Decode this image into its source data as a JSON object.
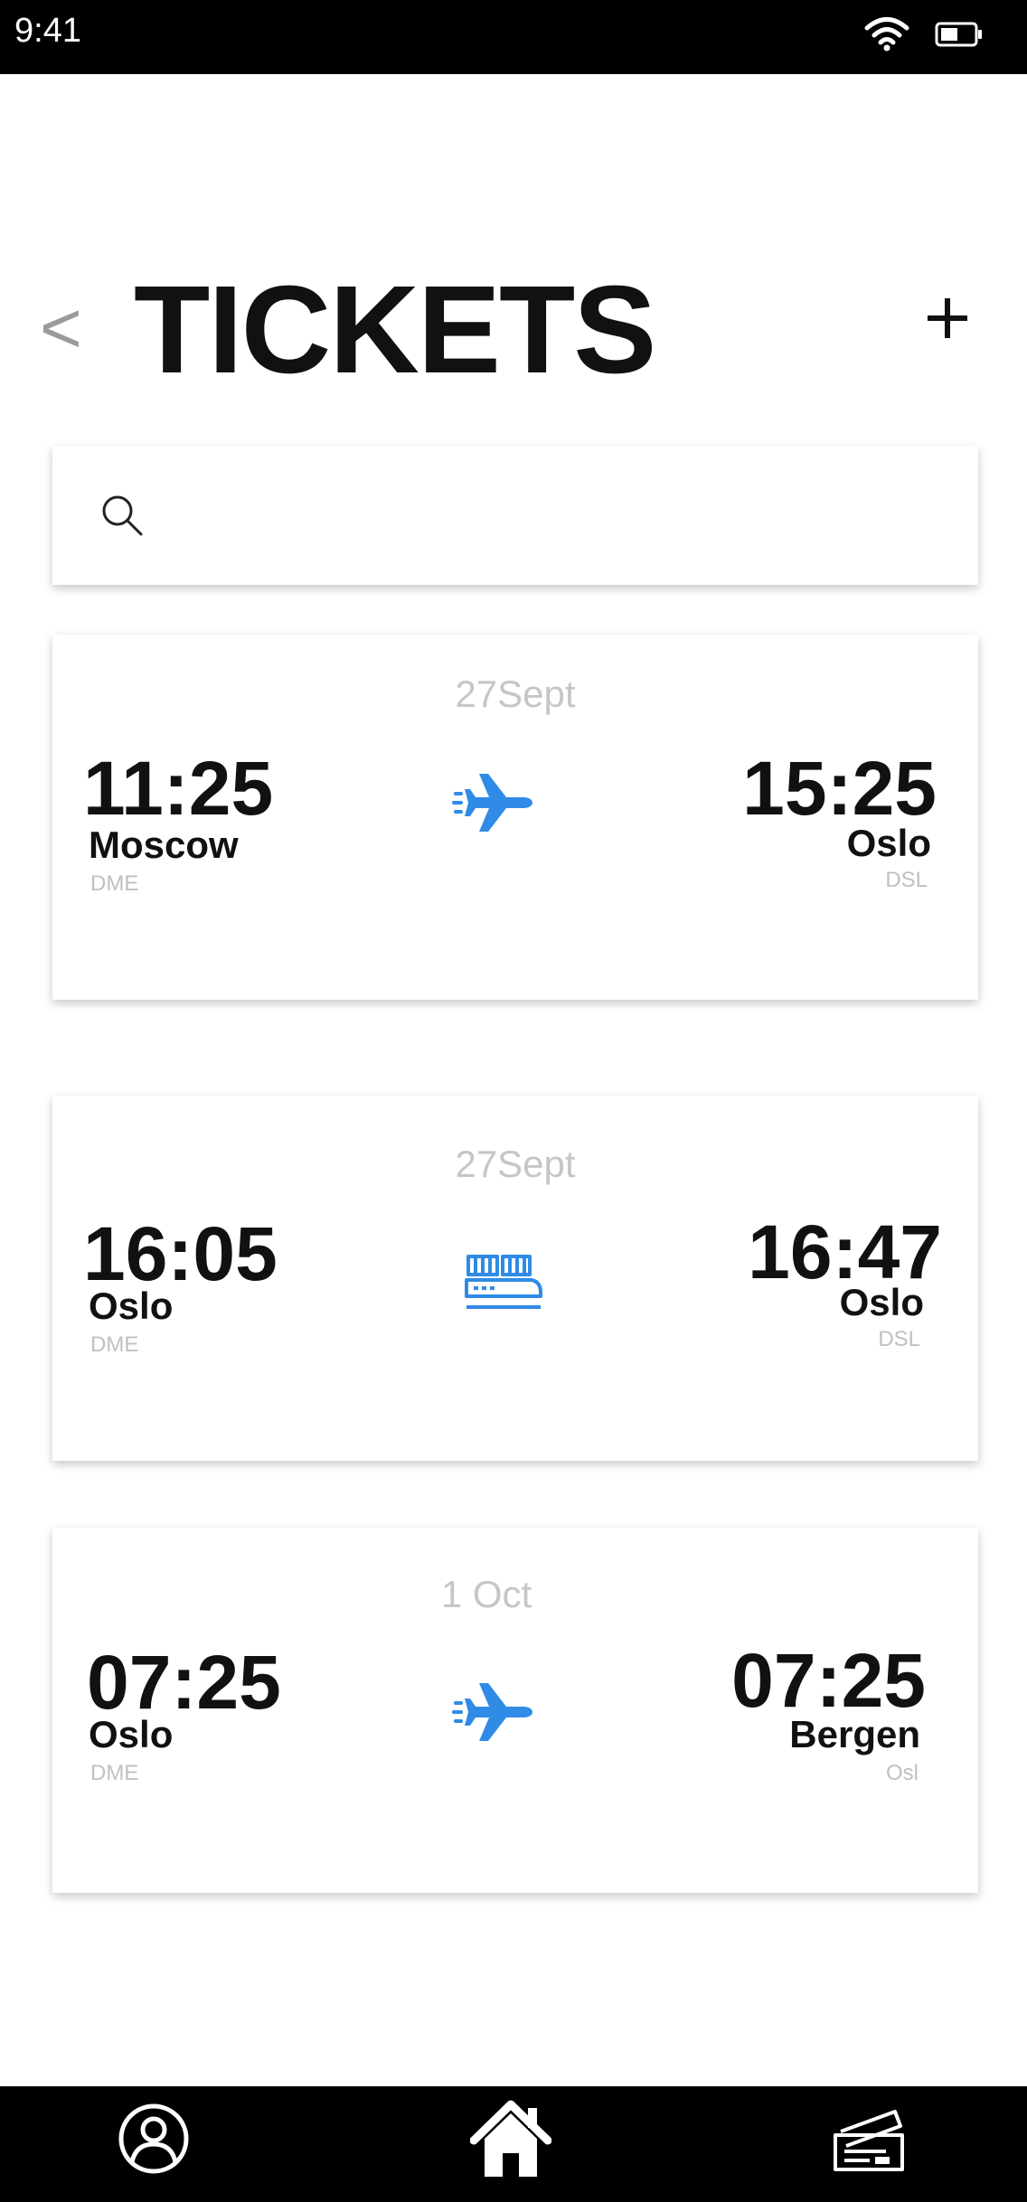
{
  "status_bar": {
    "time": "9:41"
  },
  "header": {
    "back_label": "<",
    "title": "TICKETS",
    "add_label": "+"
  },
  "search": {
    "placeholder": "",
    "value": ""
  },
  "tickets": [
    {
      "date": "27Sept",
      "transport": "airplane-icon",
      "departure": {
        "time": "11:25",
        "city": "Moscow",
        "code": "DME"
      },
      "arrival": {
        "time": "15:25",
        "city": "Oslo",
        "code": "DSL"
      }
    },
    {
      "date": "27Sept",
      "transport": "ferry-icon",
      "departure": {
        "time": "16:05",
        "city": "Oslo",
        "code": "DME"
      },
      "arrival": {
        "time": "16:47",
        "city": "Oslo",
        "code": "DSL"
      }
    },
    {
      "date": "1 Oct",
      "transport": "airplane-icon",
      "departure": {
        "time": "07:25",
        "city": "Oslo",
        "code": "DME"
      },
      "arrival": {
        "time": "07:25",
        "city": "Bergen",
        "code": "Osl"
      }
    }
  ],
  "tab_bar": {
    "items": [
      "profile-icon",
      "home-icon",
      "tickets-icon"
    ]
  },
  "colors": {
    "accent": "#2f8be6",
    "bars": "#000000",
    "muted": "#c6c6c6"
  }
}
